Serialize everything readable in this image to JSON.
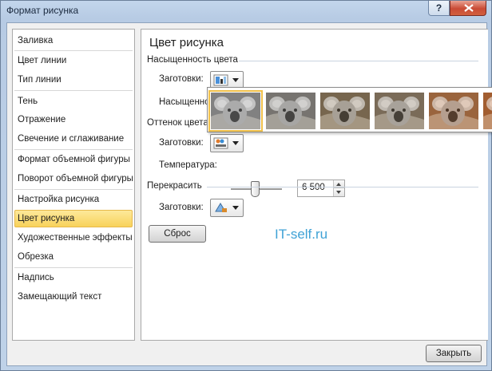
{
  "window": {
    "title": "Формат рисунка",
    "help_symbol": "?"
  },
  "nav": {
    "items": [
      {
        "label": "Заливка"
      },
      {
        "label": "Цвет линии"
      },
      {
        "label": "Тип линии"
      },
      {
        "label": "Тень"
      },
      {
        "label": "Отражение"
      },
      {
        "label": "Свечение и сглаживание"
      },
      {
        "label": "Формат объемной фигуры"
      },
      {
        "label": "Поворот объемной фигуры"
      },
      {
        "label": "Настройка рисунка"
      },
      {
        "label": "Цвет рисунка"
      },
      {
        "label": "Художественные эффекты"
      },
      {
        "label": "Обрезка"
      },
      {
        "label": "Надпись"
      },
      {
        "label": "Замещающий текст"
      }
    ],
    "active_index": 9
  },
  "panel": {
    "title": "Цвет рисунка",
    "saturation": {
      "heading": "Насыщенность цвета",
      "presets_label": "Заготовки:",
      "value_label": "Насыщенность:"
    },
    "tone": {
      "heading": "Оттенок цвета",
      "presets_label": "Заготовки:",
      "temperature_label": "Температура:",
      "temperature_value": "6 500"
    },
    "recolor": {
      "heading": "Перекрасить",
      "presets_label": "Заготовки:",
      "reset_label": "Сброс"
    }
  },
  "gallery": {
    "thumbnails": [
      {
        "tint": "#9a9a9a",
        "selected": true
      },
      {
        "tint": "#8e8b86",
        "selected": false
      },
      {
        "tint": "#8f7a5e",
        "selected": false
      },
      {
        "tint": "#93806a",
        "selected": false
      },
      {
        "tint": "#b8794a",
        "selected": false
      },
      {
        "tint": "#c26f3a",
        "selected": false
      }
    ]
  },
  "watermark": "IT-self.ru",
  "footer": {
    "close_label": "Закрыть"
  }
}
